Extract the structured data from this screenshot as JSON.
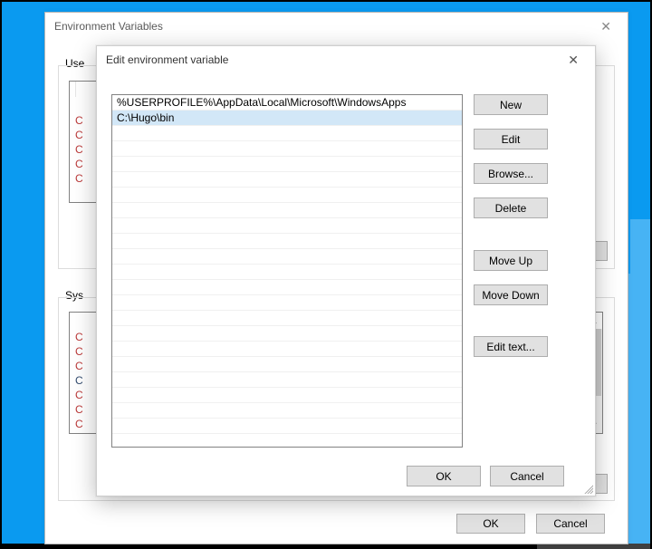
{
  "parent": {
    "title": "Environment Variables",
    "user_label_fragment": "Use",
    "sys_label_fragment": "Sys",
    "row_glyph": "C",
    "buttons": {
      "ok": "OK",
      "cancel": "Cancel"
    }
  },
  "edit": {
    "title": "Edit environment variable",
    "paths": [
      "%USERPROFILE%\\AppData\\Local\\Microsoft\\WindowsApps",
      "C:\\Hugo\\bin"
    ],
    "selected_index": 1,
    "buttons": {
      "new": "New",
      "edit": "Edit",
      "browse": "Browse...",
      "delete": "Delete",
      "move_up": "Move Up",
      "move_down": "Move Down",
      "edit_text": "Edit text...",
      "ok": "OK",
      "cancel": "Cancel"
    }
  }
}
